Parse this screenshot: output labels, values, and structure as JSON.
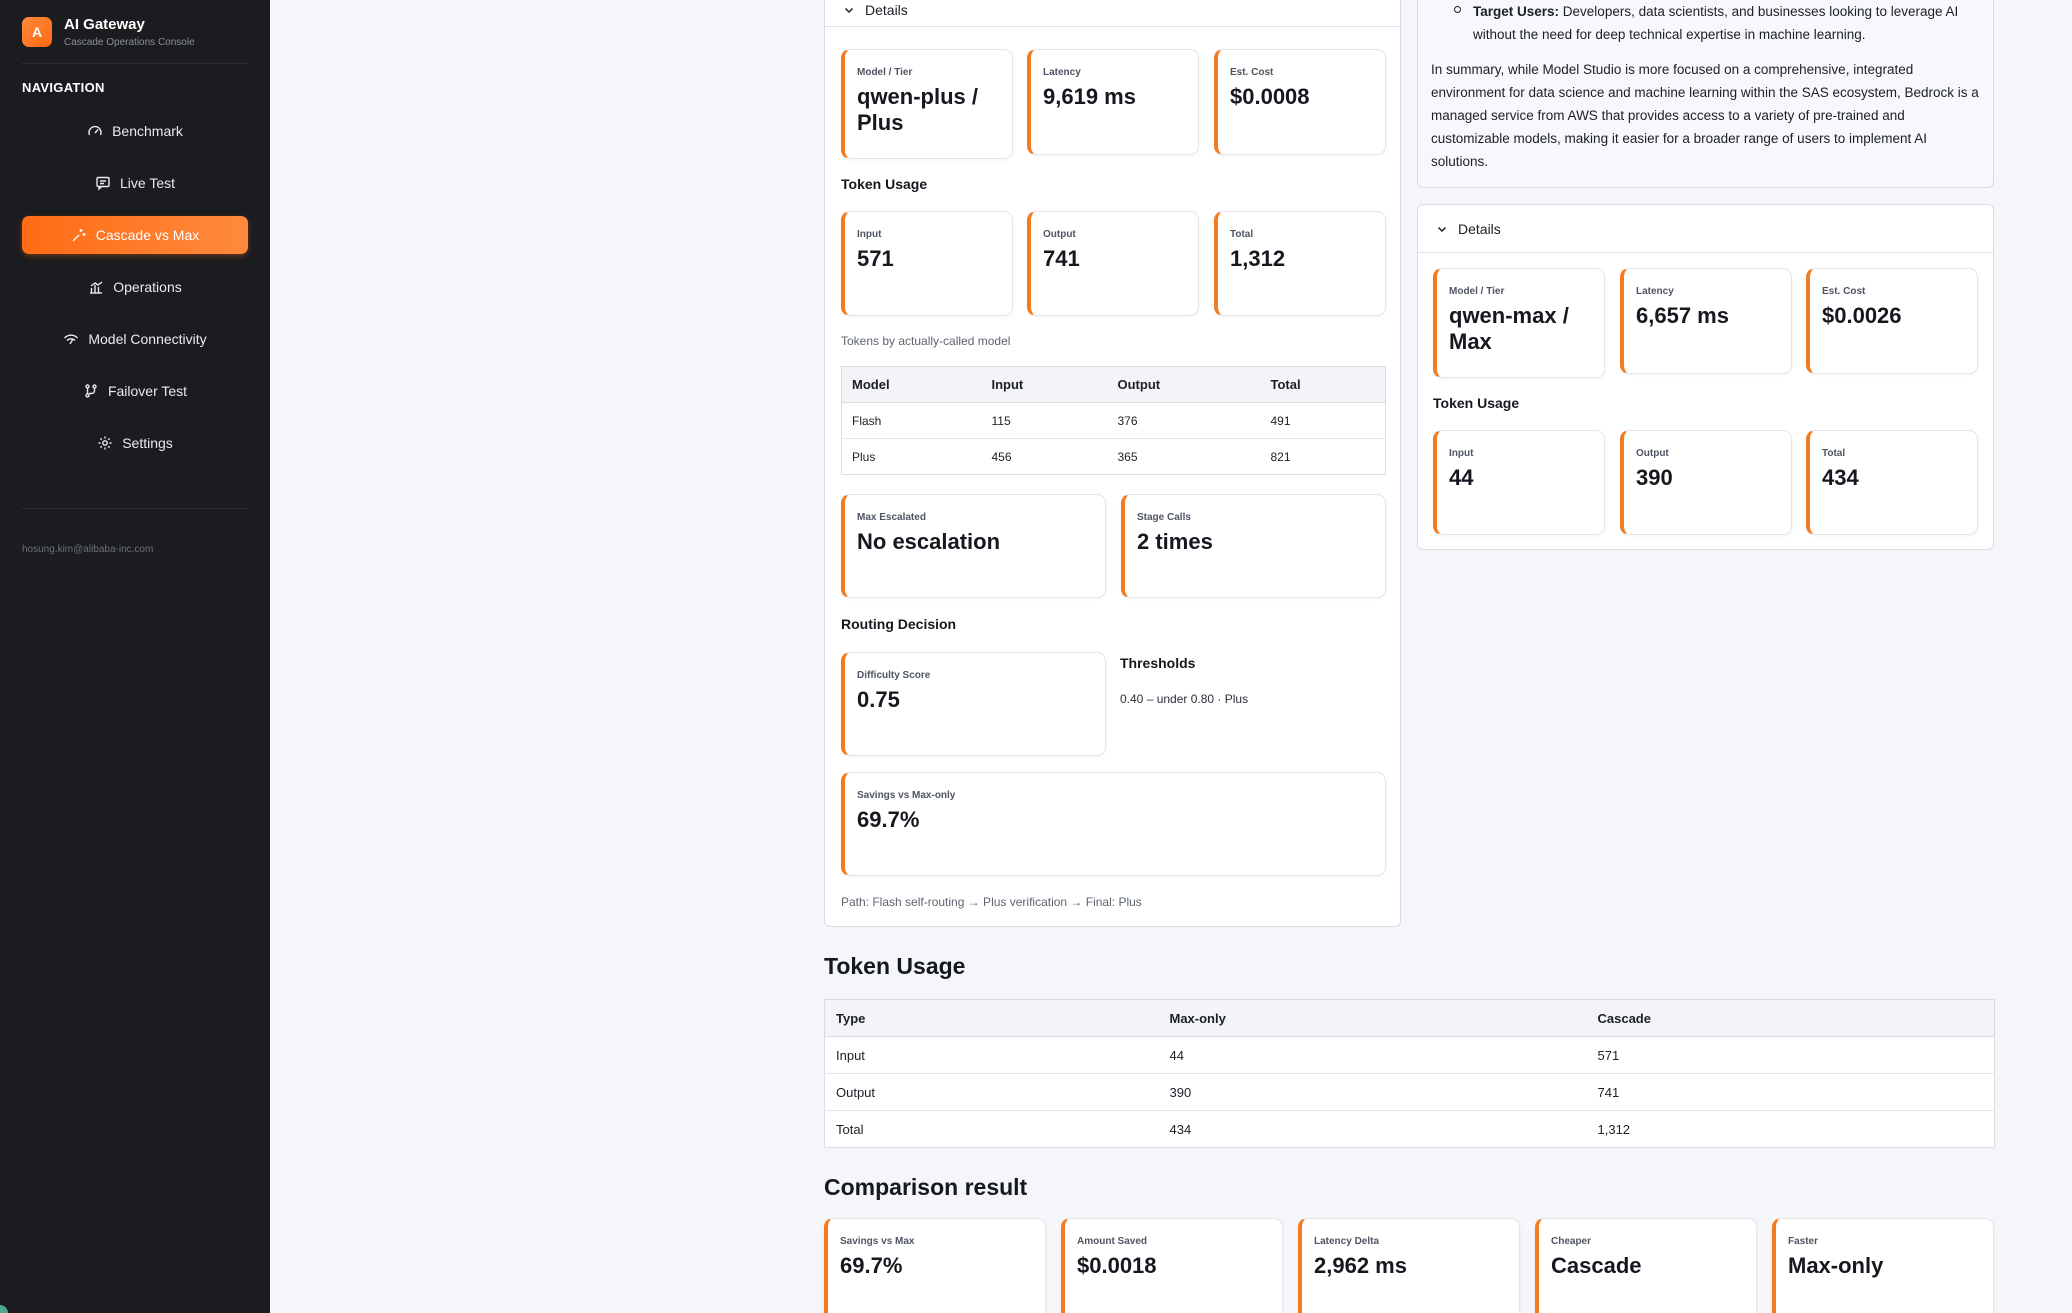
{
  "brand": {
    "logo_letter": "A",
    "title": "AI Gateway",
    "subtitle": "Cascade Operations Console"
  },
  "nav": {
    "heading": "NAVIGATION",
    "items": [
      {
        "label": "Benchmark",
        "icon": "gauge-icon"
      },
      {
        "label": "Live Test",
        "icon": "chat-icon"
      },
      {
        "label": "Cascade vs Max",
        "icon": "sparkle-icon",
        "active": true
      },
      {
        "label": "Operations",
        "icon": "chart-icon"
      },
      {
        "label": "Model Connectivity",
        "icon": "signal-icon"
      },
      {
        "label": "Failover Test",
        "icon": "branch-icon"
      },
      {
        "label": "Settings",
        "icon": "gear-icon"
      }
    ]
  },
  "user": {
    "email": "hosung.kim@alibaba-inc.com"
  },
  "accent_color": "#f47b20",
  "cascade_details": {
    "header": "Details",
    "model_tier": {
      "label": "Model / Tier",
      "value": "qwen-plus / Plus"
    },
    "latency": {
      "label": "Latency",
      "value": "9,619 ms"
    },
    "cost": {
      "label": "Est. Cost",
      "value": "$0.0008"
    },
    "token_usage_label": "Token Usage",
    "input": {
      "label": "Input",
      "value": "571"
    },
    "output": {
      "label": "Output",
      "value": "741"
    },
    "total": {
      "label": "Total",
      "value": "1,312"
    },
    "by_model_caption": "Tokens by actually-called model",
    "by_model_table": {
      "headers": [
        "Model",
        "Input",
        "Output",
        "Total"
      ],
      "rows": [
        [
          "Flash",
          "115",
          "376",
          "491"
        ],
        [
          "Plus",
          "456",
          "365",
          "821"
        ]
      ]
    },
    "max_escalated": {
      "label": "Max Escalated",
      "value": "No escalation"
    },
    "stage_calls": {
      "label": "Stage Calls",
      "value": "2 times"
    },
    "routing_label": "Routing Decision",
    "difficulty": {
      "label": "Difficulty Score",
      "value": "0.75"
    },
    "thresholds_title": "Thresholds",
    "thresholds_text": "0.40 – under 0.80 · Plus",
    "savings": {
      "label": "Savings vs Max-only",
      "value": "69.7%"
    },
    "path": "Path: Flash self-routing → Plus verification → Final: Plus"
  },
  "max_summary": {
    "bullet_term": "Target Users:",
    "bullet_text": "Developers, data scientists, and businesses looking to leverage AI without the need for deep technical expertise in machine learning.",
    "paragraph": "In summary, while Model Studio is more focused on a comprehensive, integrated environment for data science and machine learning within the SAS ecosystem, Bedrock is a managed service from AWS that provides access to a variety of pre-trained and customizable models, making it easier for a broader range of users to implement AI solutions."
  },
  "max_details": {
    "header": "Details",
    "model_tier": {
      "label": "Model / Tier",
      "value": "qwen-max / Max"
    },
    "latency": {
      "label": "Latency",
      "value": "6,657 ms"
    },
    "cost": {
      "label": "Est. Cost",
      "value": "$0.0026"
    },
    "token_usage_label": "Token Usage",
    "input": {
      "label": "Input",
      "value": "44"
    },
    "output": {
      "label": "Output",
      "value": "390"
    },
    "total": {
      "label": "Total",
      "value": "434"
    }
  },
  "token_usage": {
    "heading": "Token Usage",
    "headers": [
      "Type",
      "Max-only",
      "Cascade"
    ],
    "rows": [
      [
        "Input",
        "44",
        "571"
      ],
      [
        "Output",
        "390",
        "741"
      ],
      [
        "Total",
        "434",
        "1,312"
      ]
    ]
  },
  "comparison": {
    "heading": "Comparison result",
    "cards": [
      {
        "label": "Savings vs Max",
        "value": "69.7%"
      },
      {
        "label": "Amount Saved",
        "value": "$0.0018"
      },
      {
        "label": "Latency Delta",
        "value": "2,962 ms"
      },
      {
        "label": "Cheaper",
        "value": "Cascade"
      },
      {
        "label": "Faster",
        "value": "Max-only"
      }
    ]
  }
}
